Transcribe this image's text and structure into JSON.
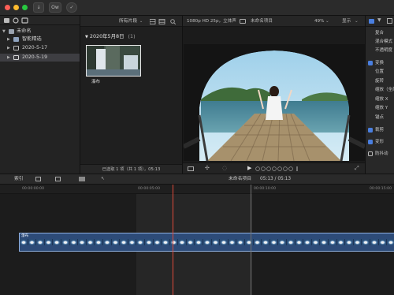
{
  "titlebar": {
    "import_label": "↓",
    "keyword_label": "Ow",
    "check_label": "✓"
  },
  "library": {
    "items": [
      {
        "label": "未命名",
        "type": "library"
      },
      {
        "label": "智能精选",
        "type": "folder"
      },
      {
        "label": "2020-5-17",
        "type": "event"
      },
      {
        "label": "2020-5-19",
        "type": "event",
        "selected": true
      }
    ]
  },
  "browser": {
    "filter_label": "所有片段",
    "date_header": "2020年5月8日",
    "date_count": "(1)",
    "clip_label": "瀑布",
    "status": "已选取 1 项（共 1 项），05:13"
  },
  "viewer": {
    "format": "1080p HD 25p，立体声",
    "project_name": "未命名项目",
    "zoom": "49%",
    "display_label": "显示"
  },
  "inspector": {
    "rows": [
      {
        "label": "复合",
        "checkbox": false
      },
      {
        "label": "混合模式",
        "checkbox": false
      },
      {
        "label": "不透明度",
        "checkbox": false
      },
      {
        "label": "变换",
        "checkbox": true
      },
      {
        "label": "位置",
        "checkbox": false
      },
      {
        "label": "旋转",
        "checkbox": false
      },
      {
        "label": "缩放（全部）",
        "checkbox": false
      },
      {
        "label": "缩放 X",
        "checkbox": false
      },
      {
        "label": "缩放 Y",
        "checkbox": false
      },
      {
        "label": "锚点",
        "checkbox": false
      },
      {
        "label": "裁剪",
        "checkbox": true
      },
      {
        "label": "变形",
        "checkbox": true
      },
      {
        "label": "防抖动",
        "checkbox": false,
        "unchecked_box": true
      }
    ]
  },
  "timeline": {
    "index_label": "索引",
    "project_name": "未命名项目",
    "duration": "05:13 / 05:13",
    "ruler_marks": [
      "00:00:00:00",
      "00:00:05:00",
      "00:00:10:00",
      "00:00:15:00"
    ],
    "clip_name": "瀑布"
  },
  "colors": {
    "accent": "#4a7fe0",
    "clip_fill": "#2d4b78",
    "playhead": "#e04a3a"
  }
}
